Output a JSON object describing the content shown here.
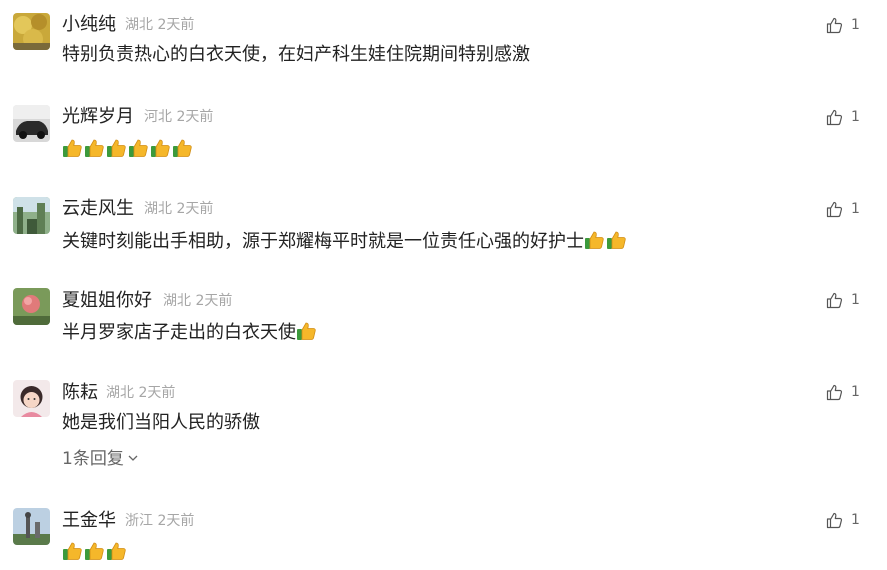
{
  "comments": [
    {
      "name": "小纯纯",
      "location": "湖北",
      "time": "2天前",
      "text": "特别负责热心的白衣天使，在妇产科生娃住院期间特别感激",
      "thumbs": 0,
      "likes": "1"
    },
    {
      "name": "光辉岁月",
      "location": "河北",
      "time": "2天前",
      "text": "",
      "thumbs": 6,
      "likes": "1"
    },
    {
      "name": "云走风生",
      "location": "湖北",
      "time": "2天前",
      "text": "关键时刻能出手相助，源于郑耀梅平时就是一位责任心强的好护士",
      "thumbs": 2,
      "likes": "1"
    },
    {
      "name": "夏姐姐你好",
      "location": "湖北",
      "time": "2天前",
      "text": "半月罗家店子走出的白衣天使",
      "thumbs": 1,
      "likes": "1"
    },
    {
      "name": "陈耘",
      "location": "湖北",
      "time": "2天前",
      "text": "她是我们当阳人民的骄傲",
      "thumbs": 0,
      "likes": "1",
      "replies": "1条回复"
    },
    {
      "name": "王金华",
      "location": "浙江",
      "time": "2天前",
      "text": "",
      "thumbs": 3,
      "likes": "1"
    }
  ],
  "icons": {
    "like": "thumbs-up-outline-icon",
    "emoji": "thumbs-up-emoji-icon",
    "chevron": "chevron-down-icon"
  }
}
